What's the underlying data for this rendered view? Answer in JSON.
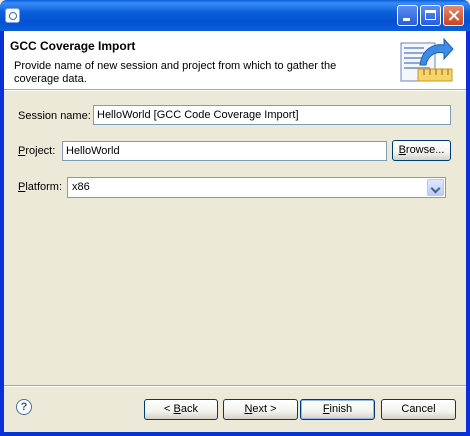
{
  "window": {
    "icon": "eclipse-app-icon",
    "controls": {
      "minimize": "minimize-icon",
      "maximize": "maximize-icon",
      "close": "close-icon"
    }
  },
  "header": {
    "title": "GCC Coverage Import",
    "description": "Provide name of new session and project from which to gather the coverage data.",
    "icon": "import-wizard-icon"
  },
  "form": {
    "session_label_prefix": "Session name:",
    "session_value": "HelloWorld [GCC Code Coverage Import]",
    "project_mnemonic": "P",
    "project_label_rest": "roject:",
    "project_value": "HelloWorld",
    "browse_mnemonic": "B",
    "browse_rest": "rowse...",
    "platform_mnemonic": "P",
    "platform_label_rest": "latform:",
    "platform_value": "x86"
  },
  "footer": {
    "help_icon": "help-icon",
    "help_glyph": "?",
    "back_prefix": "< ",
    "back_mnemonic": "B",
    "back_rest": "ack",
    "next_mnemonic": "N",
    "next_rest": "ext >",
    "finish_mnemonic": "F",
    "finish_rest": "inish",
    "cancel_label": "Cancel"
  }
}
